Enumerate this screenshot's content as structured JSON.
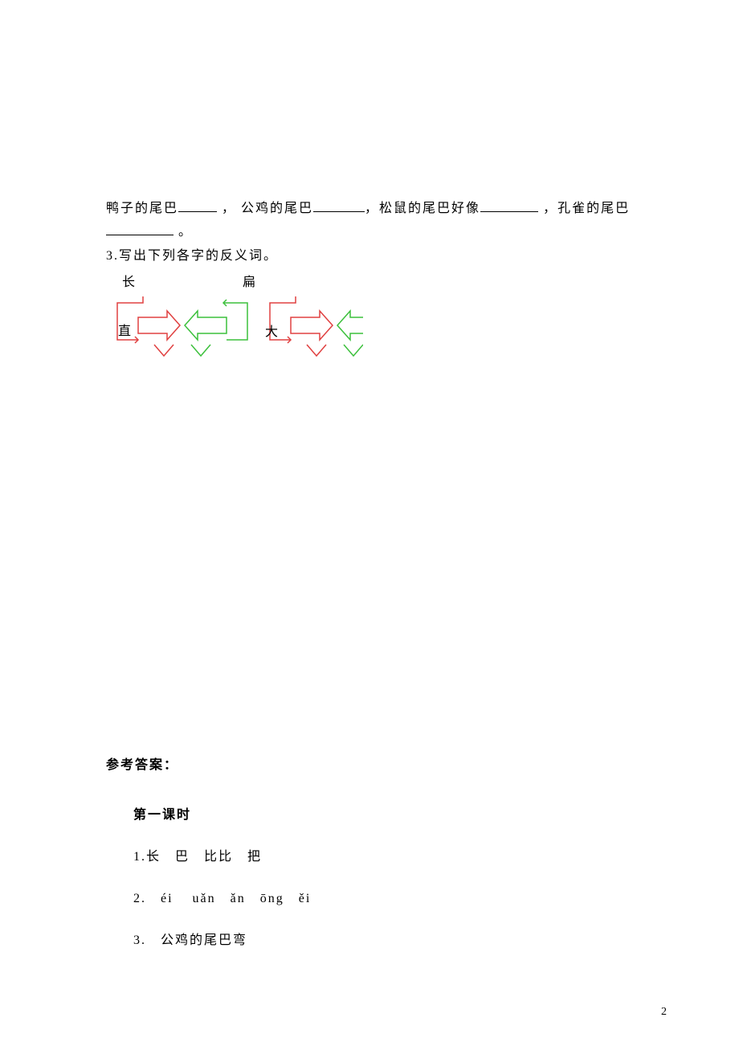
{
  "q2": {
    "p1": "鸭子的尾巴",
    "c": "，",
    "p2": "公鸡的尾巴",
    "c2": "，松鼠的尾巴好像",
    "c3": "，孔雀的尾巴",
    "period": " 。"
  },
  "q3": {
    "label": "3.写出下列各字的反义词。",
    "chang": "长",
    "bian": "扁",
    "zhi": "直",
    "da": "大"
  },
  "answers": {
    "title": "参考答案：",
    "lesson": "第一课时",
    "a1": "1.长　巴　比比　把",
    "a2": "2.　éi　 uǎn　ǎn　ōng　ěi",
    "a3": "3.　公鸡的尾巴弯"
  },
  "pageNumber": "2"
}
